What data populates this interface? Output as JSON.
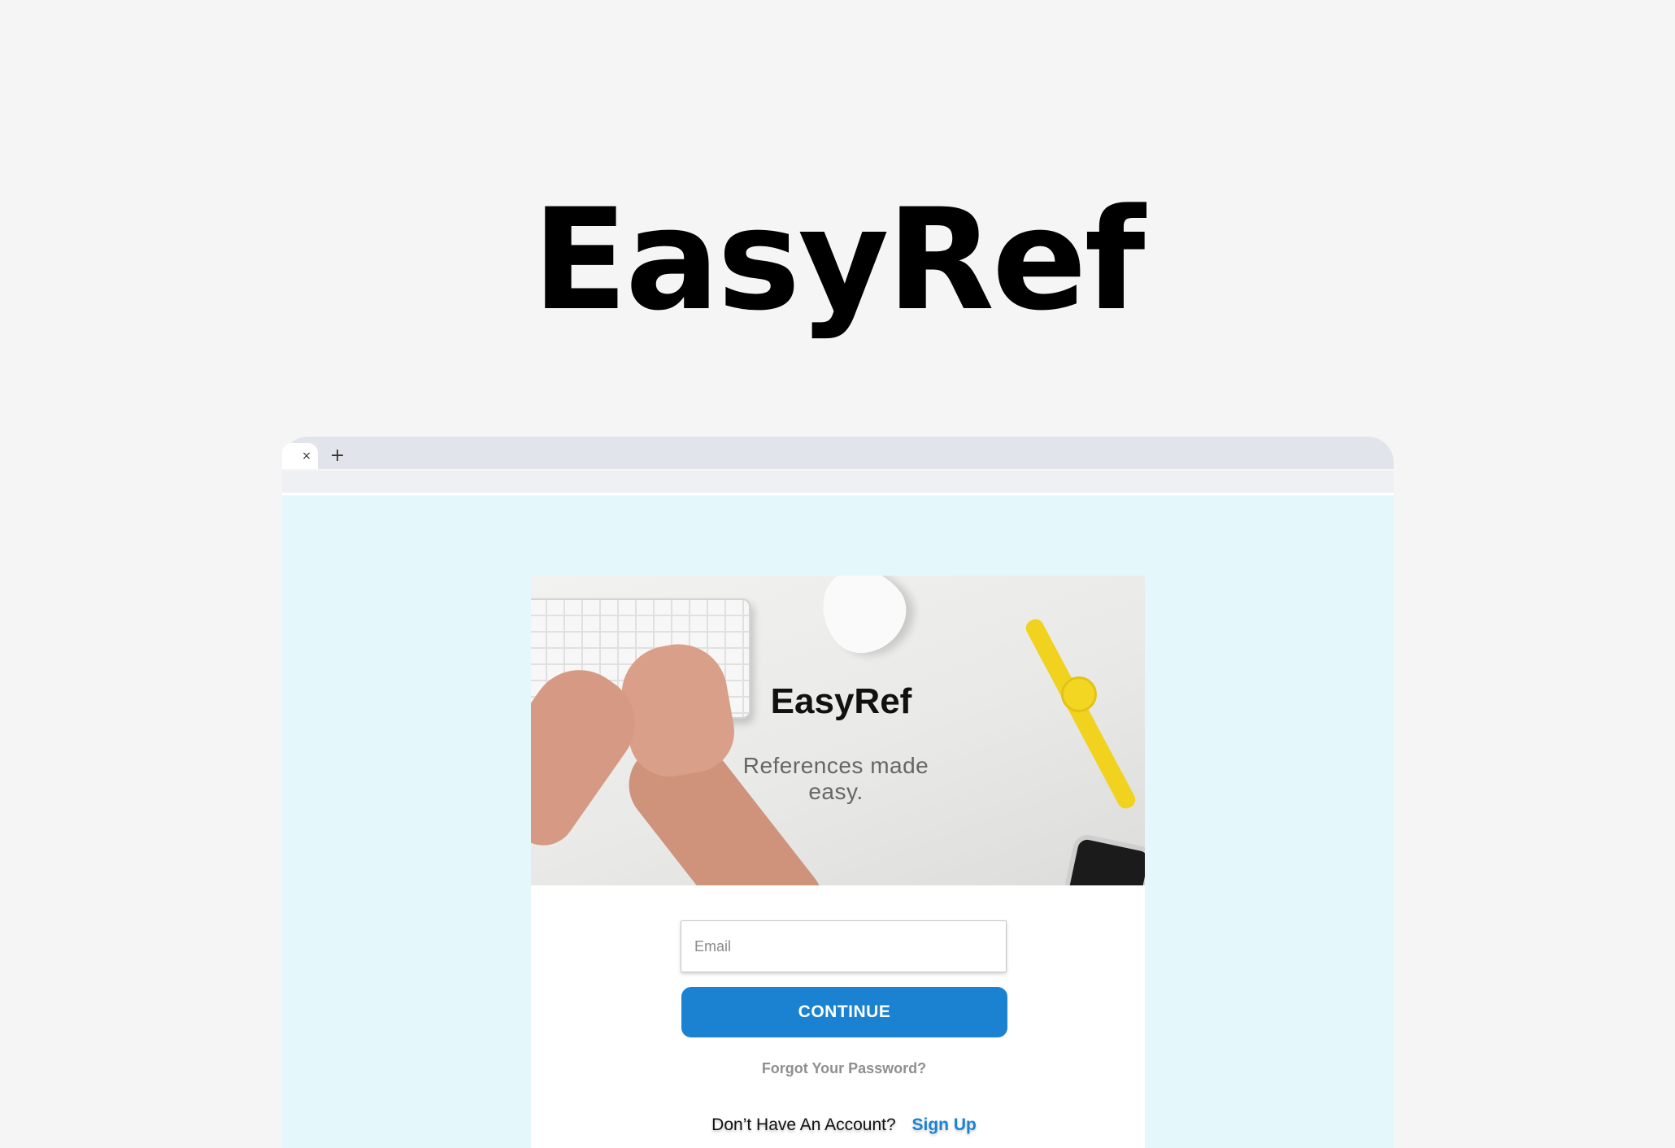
{
  "page": {
    "title": "EasyRef"
  },
  "browser": {
    "tab_close_icon": "×",
    "new_tab_icon": "+"
  },
  "hero": {
    "title": "EasyRef",
    "subtitle": "References made easy."
  },
  "login": {
    "email_placeholder": "Email",
    "email_value": "",
    "continue_label": "CONTINUE",
    "forgot_label": "Forgot Your Password?",
    "signup_prompt": "Don’t Have An Account?",
    "signup_label": "Sign Up"
  },
  "colors": {
    "background": "#f5f5f5",
    "viewport_background": "#e4f8fc",
    "accent": "#1a82d1",
    "tabbar": "#e1e4ea"
  }
}
